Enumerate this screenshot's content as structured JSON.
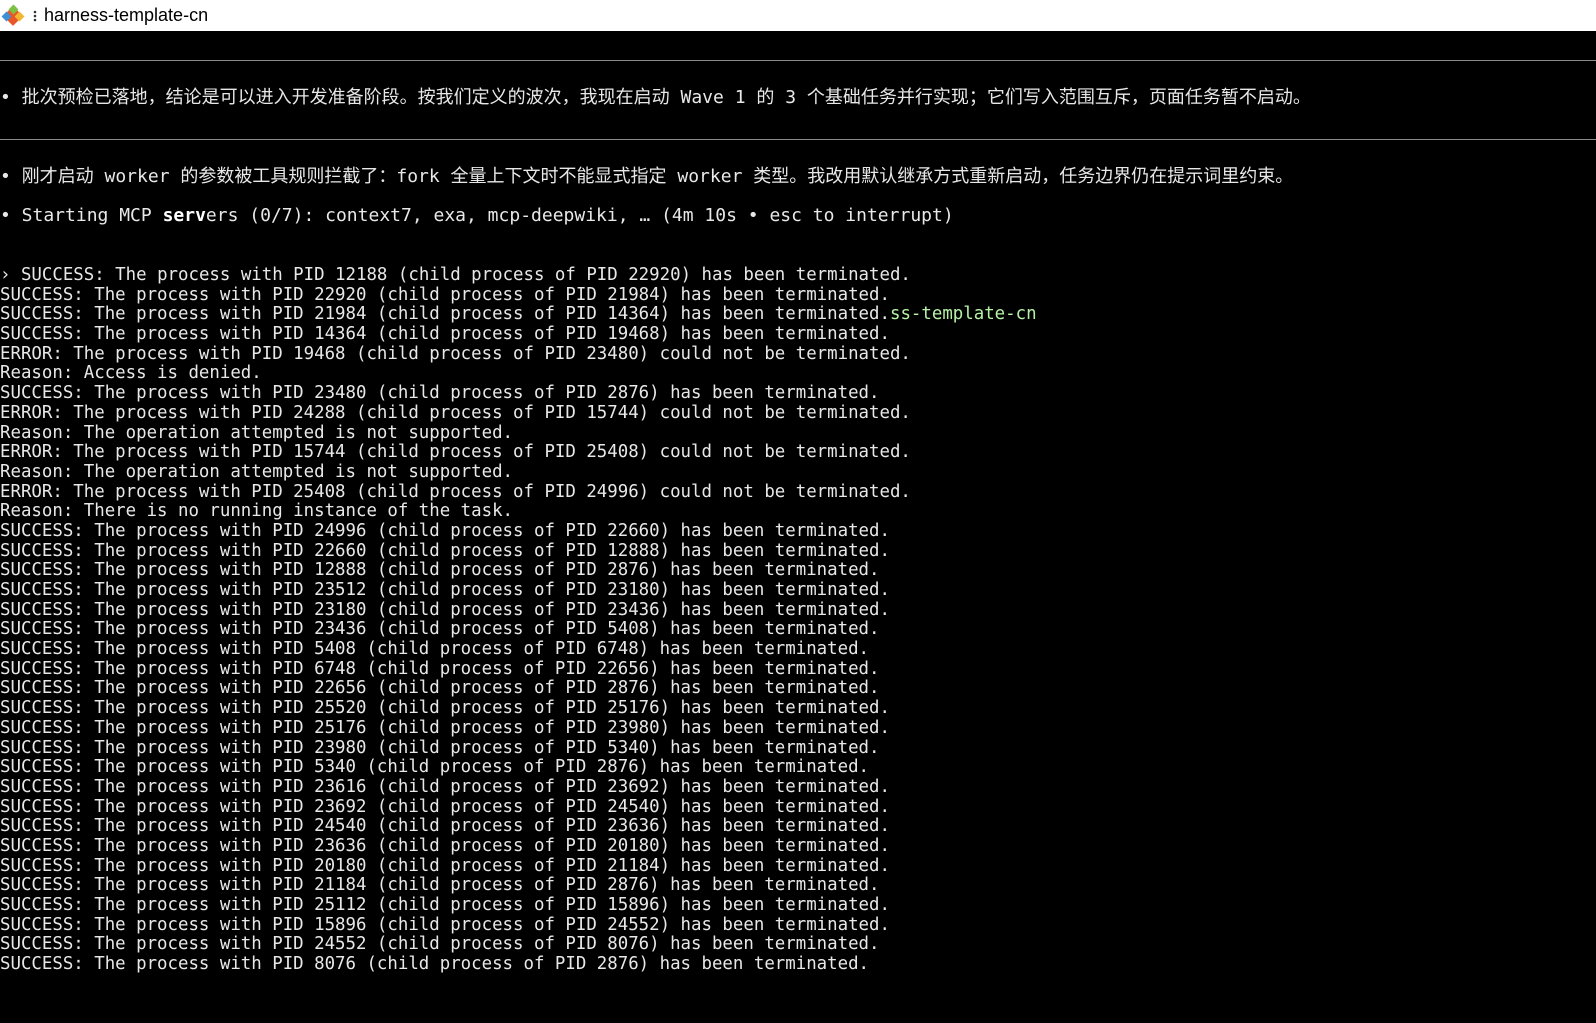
{
  "window": {
    "title": "harness-template-cn",
    "app_icon": "git-diamond-icon",
    "menu_icon": "vertical-dots-icon"
  },
  "messages": {
    "msg1": "• 批次预检已落地，结论是可以进入开发准备阶段。按我们定义的波次，我现在启动 Wave 1 的 3 个基础任务并行实现；它们写入范围互斥，页面任务暂不启动。",
    "msg2": "• 刚才启动 worker 的参数被工具规则拦截了：fork 全量上下文时不能显式指定 worker 类型。我改用默认继承方式重新启动，任务边界仍在提示词里约束。"
  },
  "status": {
    "prefix": "• Starting MCP ",
    "bold": "serv",
    "suffix": "ers (0/7): context7, exa, mcp-deepwiki, … (4m 10s • esc to interrupt)"
  },
  "log": {
    "first_prefix": "› ",
    "overlay_text": "ss-template-cn",
    "lines": [
      "SUCCESS: The process with PID 12188 (child process of PID 22920) has been terminated.",
      "SUCCESS: The process with PID 22920 (child process of PID 21984) has been terminated.",
      "SUCCESS: The process with PID 21984 (child process of PID 14364) has been terminated.",
      "SUCCESS: The process with PID 14364 (child process of PID 19468) has been terminated.",
      "ERROR: The process with PID 19468 (child process of PID 23480) could not be terminated.",
      "Reason: Access is denied.",
      "SUCCESS: The process with PID 23480 (child process of PID 2876) has been terminated.",
      "ERROR: The process with PID 24288 (child process of PID 15744) could not be terminated.",
      "Reason: The operation attempted is not supported.",
      "ERROR: The process with PID 15744 (child process of PID 25408) could not be terminated.",
      "Reason: The operation attempted is not supported.",
      "ERROR: The process with PID 25408 (child process of PID 24996) could not be terminated.",
      "Reason: There is no running instance of the task.",
      "SUCCESS: The process with PID 24996 (child process of PID 22660) has been terminated.",
      "SUCCESS: The process with PID 22660 (child process of PID 12888) has been terminated.",
      "SUCCESS: The process with PID 12888 (child process of PID 2876) has been terminated.",
      "SUCCESS: The process with PID 23512 (child process of PID 23180) has been terminated.",
      "SUCCESS: The process with PID 23180 (child process of PID 23436) has been terminated.",
      "SUCCESS: The process with PID 23436 (child process of PID 5408) has been terminated.",
      "SUCCESS: The process with PID 5408 (child process of PID 6748) has been terminated.",
      "SUCCESS: The process with PID 6748 (child process of PID 22656) has been terminated.",
      "SUCCESS: The process with PID 22656 (child process of PID 2876) has been terminated.",
      "SUCCESS: The process with PID 25520 (child process of PID 25176) has been terminated.",
      "SUCCESS: The process with PID 25176 (child process of PID 23980) has been terminated.",
      "SUCCESS: The process with PID 23980 (child process of PID 5340) has been terminated.",
      "SUCCESS: The process with PID 5340 (child process of PID 2876) has been terminated.",
      "SUCCESS: The process with PID 23616 (child process of PID 23692) has been terminated.",
      "SUCCESS: The process with PID 23692 (child process of PID 24540) has been terminated.",
      "SUCCESS: The process with PID 24540 (child process of PID 23636) has been terminated.",
      "SUCCESS: The process with PID 23636 (child process of PID 20180) has been terminated.",
      "SUCCESS: The process with PID 20180 (child process of PID 21184) has been terminated.",
      "SUCCESS: The process with PID 21184 (child process of PID 2876) has been terminated.",
      "SUCCESS: The process with PID 25112 (child process of PID 15896) has been terminated.",
      "SUCCESS: The process with PID 15896 (child process of PID 24552) has been terminated.",
      "SUCCESS: The process with PID 24552 (child process of PID 8076) has been terminated.",
      "SUCCESS: The process with PID 8076 (child process of PID 2876) has been terminated."
    ]
  },
  "colors": {
    "background": "#000000",
    "text": "#e8e8e8",
    "accent_green": "#b6f2a6",
    "titlebar": "#ffffff"
  }
}
